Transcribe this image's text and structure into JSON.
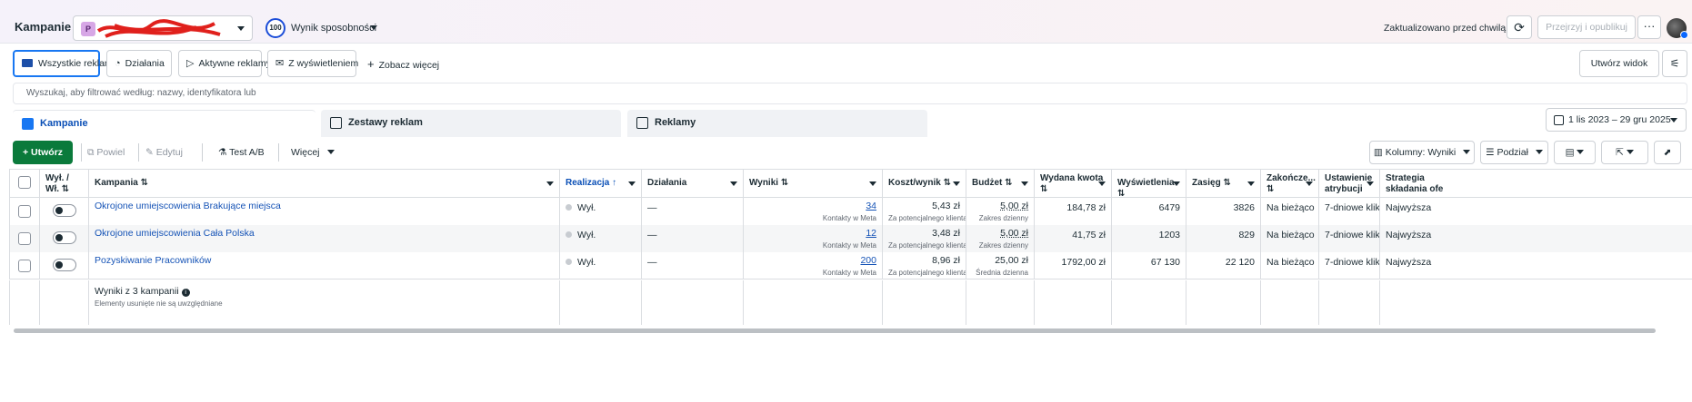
{
  "header": {
    "title": "Kampanie",
    "account_badge": "P",
    "score_value": "100",
    "score_label": "Wynik sposobności",
    "updated_text": "Zaktualizowano przed chwilą",
    "review_label": "Przejrzyj i opublikuj",
    "more_label": "···"
  },
  "filters": {
    "all_ads": "Wszystkie reklamy",
    "actions": "Działania",
    "active_ads": "Aktywne reklamy",
    "with_impressions": "Z wyświetleniem",
    "see_more": "Zobacz więcej",
    "create_view": "Utwórz widok"
  },
  "search": {
    "placeholder": "Wyszukaj, aby filtrować według: nazwy, identyfikatora lub"
  },
  "tabs": {
    "campaigns": "Kampanie",
    "adsets": "Zestawy reklam",
    "ads": "Reklamy"
  },
  "date_range": "1 lis 2023 – 29 gru 2025",
  "toolbar": {
    "create": "Utwórz",
    "duplicate": "Powiel",
    "edit": "Edytuj",
    "ab_test": "Test A/B",
    "more": "Więcej",
    "columns": "Kolumny: Wyniki",
    "breakdown": "Podział"
  },
  "table": {
    "headers": {
      "onoff": "Wył. / Wł. ⇅",
      "campaign": "Kampania ⇅",
      "delivery": "Realizacja ↑",
      "actions": "Działania",
      "results": "Wyniki ⇅",
      "cost_result": "Koszt/wynik ⇅",
      "budget": "Budżet ⇅",
      "spent": "Wydana kwota",
      "spent_sort": "⇅",
      "impressions": "Wyświetlenia ⇅",
      "reach": "Zasięg ⇅",
      "ends": "Zakończe...",
      "ends_sort": "⇅",
      "attribution": "Ustawienie",
      "attribution2": "atrybucji",
      "strategy": "Strategia",
      "strategy2": "składania ofe"
    },
    "rows": [
      {
        "name": "Okrojone umiejscowienia Brakujące miejsca",
        "delivery": "Wył.",
        "actions": "—",
        "results": "34",
        "results_sub": "Kontakty w Meta",
        "cost": "5,43 zł",
        "cost_sub": "Za potencjalnego klienta ...",
        "budget": "5,00 zł",
        "budget_sub": "Zakres dzienny",
        "spent": "184,78 zł",
        "impressions": "6479",
        "reach": "3826",
        "ends": "Na bieżąco",
        "attribution": "7-dniowe klik...",
        "strategy": "Najwyższa"
      },
      {
        "name": "Okrojone umiejscowienia Cała Polska",
        "delivery": "Wył.",
        "actions": "—",
        "results": "12",
        "results_sub": "Kontakty w Meta",
        "cost": "3,48 zł",
        "cost_sub": "Za potencjalnego klienta ...",
        "budget": "5,00 zł",
        "budget_sub": "Zakres dzienny",
        "spent": "41,75 zł",
        "impressions": "1203",
        "reach": "829",
        "ends": "Na bieżąco",
        "attribution": "7-dniowe klik...",
        "strategy": "Najwyższa"
      },
      {
        "name": "Pozyskiwanie Pracowników",
        "delivery": "Wył.",
        "actions": "—",
        "results": "200",
        "results_sub": "Kontakty w Meta",
        "cost": "8,96 zł",
        "cost_sub": "Za potencjalnego klienta ...",
        "budget": "25,00 zł",
        "budget_sub": "Średnia dzienna",
        "spent": "1792,00 zł",
        "impressions": "67 130",
        "reach": "22 120",
        "ends": "Na bieżąco",
        "attribution": "7-dniowe klik...",
        "strategy": "Najwyższa"
      }
    ],
    "summary": {
      "title": "Wyniki z 3 kampanii",
      "note": "Elementy usunięte nie są uwzględniane"
    }
  }
}
